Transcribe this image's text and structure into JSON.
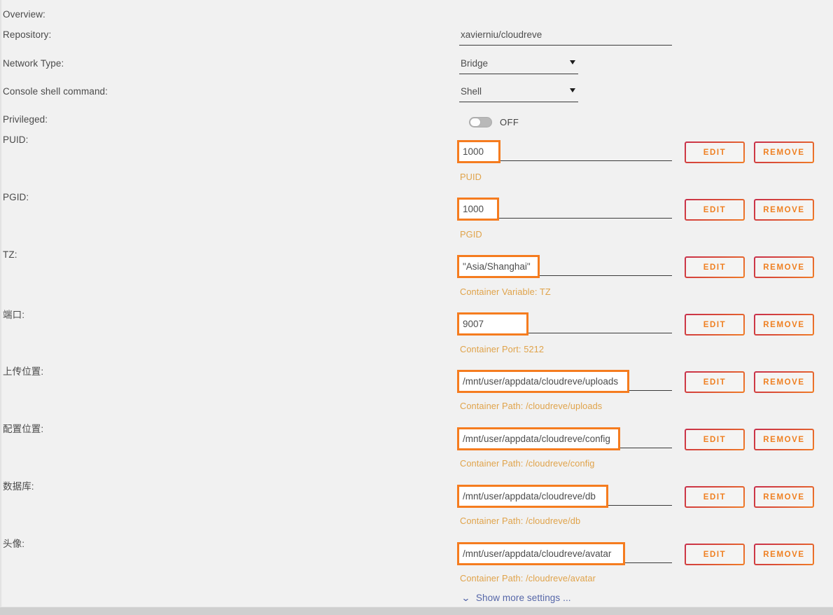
{
  "form": {
    "rows": [
      {
        "id": "overview",
        "label": "Overview:",
        "control": "none",
        "value": "",
        "helper": "",
        "edit_label": "",
        "remove_label": ""
      },
      {
        "id": "repository",
        "label": "Repository:",
        "control": "text",
        "value": "xavierniu/cloudreve",
        "helper": "",
        "edit_label": "",
        "remove_label": ""
      },
      {
        "id": "network-type",
        "label": "Network Type:",
        "control": "select",
        "value": "Bridge",
        "helper": "",
        "edit_label": "",
        "remove_label": ""
      },
      {
        "id": "console-shell-command",
        "label": "Console shell command:",
        "control": "select",
        "value": "Shell",
        "helper": "",
        "edit_label": "",
        "remove_label": ""
      },
      {
        "id": "privileged",
        "label": "Privileged:",
        "control": "toggle",
        "value": "OFF",
        "toggle_state": "off",
        "helper": "",
        "edit_label": "",
        "remove_label": ""
      },
      {
        "id": "puid",
        "label": "PUID:",
        "control": "highlighted-text",
        "value": "1000",
        "helper": "PUID",
        "edit_label": "EDIT",
        "remove_label": "REMOVE"
      },
      {
        "id": "pgid",
        "label": "PGID:",
        "control": "highlighted-text",
        "value": "1000",
        "helper": "PGID",
        "edit_label": "EDIT",
        "remove_label": "REMOVE"
      },
      {
        "id": "tz",
        "label": "TZ:",
        "control": "highlighted-text",
        "value": "\"Asia/Shanghai\"",
        "helper": "Container Variable: TZ",
        "edit_label": "EDIT",
        "remove_label": "REMOVE"
      },
      {
        "id": "port",
        "label": "端口:",
        "control": "highlighted-text",
        "value": "9007",
        "helper": "Container Port: 5212",
        "edit_label": "EDIT",
        "remove_label": "REMOVE"
      },
      {
        "id": "upload-location",
        "label": "上传位置:",
        "control": "highlighted-text",
        "value": "/mnt/user/appdata/cloudreve/uploads",
        "helper": "Container Path: /cloudreve/uploads",
        "edit_label": "EDIT",
        "remove_label": "REMOVE"
      },
      {
        "id": "config-location",
        "label": "配置位置:",
        "control": "highlighted-text",
        "value": "/mnt/user/appdata/cloudreve/config",
        "helper": "Container Path: /cloudreve/config",
        "edit_label": "EDIT",
        "remove_label": "REMOVE"
      },
      {
        "id": "database",
        "label": "数据库:",
        "control": "highlighted-text",
        "value": "/mnt/user/appdata/cloudreve/db",
        "helper": "Container Path: /cloudreve/db",
        "edit_label": "EDIT",
        "remove_label": "REMOVE"
      },
      {
        "id": "avatar",
        "label": "头像:",
        "control": "highlighted-text",
        "value": "/mnt/user/appdata/cloudreve/avatar",
        "helper": "Container Path: /cloudreve/avatar",
        "edit_label": "EDIT",
        "remove_label": "REMOVE"
      }
    ]
  },
  "show_more": {
    "label": "Show more settings ...",
    "icon": "chevron-down-icon",
    "glyph": "⌄"
  },
  "colors": {
    "page_background": "#f1f1f1",
    "highlight_box": "#f57c1f",
    "helper_text": "#e0a34a",
    "button_text": "#ef8022",
    "button_border_start": "#c8304b",
    "button_border_end": "#f07c26",
    "link": "#5566a8",
    "underline": "#3a3a3a"
  }
}
